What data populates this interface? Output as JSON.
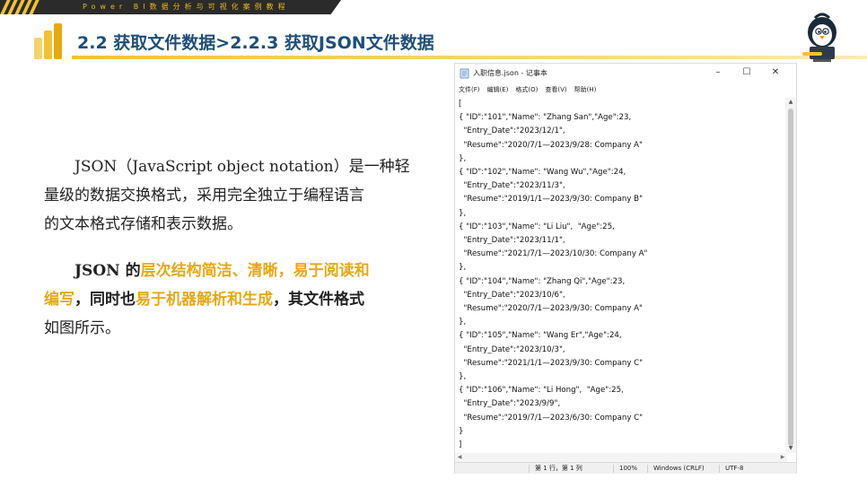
{
  "banner": {
    "text": "Power BI数据分析与可视化案例教程"
  },
  "header": {
    "title": "2.2  获取文件数据>2.2.3  获取JSON文件数据"
  },
  "colors": {
    "accent": "#f2c232",
    "title": "#1f4e79",
    "highlight": "#e6a817"
  },
  "paragraph1": {
    "line1": "JSON（JavaScript object notation）是一种轻",
    "line2": "量级的数据交换格式，采用完全独立于编程语言",
    "line3": "的文本格式存储和表示数据。"
  },
  "paragraph2": {
    "p1": "JSON ",
    "p2": "的",
    "hl1": "层次结构简洁、清晰，易于阅读和",
    "hl2": "编写",
    "p3": "，同时也",
    "hl3": "易于机器解析和生成",
    "p4": "，其文件格式",
    "p5": "如图所示。"
  },
  "notepad": {
    "title": "入职信息.json - 记事本",
    "controls": {
      "minimize": "–",
      "maximize": "☐",
      "close": "✕"
    },
    "menus": [
      "文件(F)",
      "编辑(E)",
      "格式(O)",
      "查看(V)",
      "帮助(H)"
    ],
    "content": "[\n{ \"ID\":\"101\",\"Name\": \"Zhang San\",\"Age\":23,\n  \"Entry_Date\":\"2023/12/1\",\n  \"Resume\":\"2020/7/1—2023/9/28: Company A\"\n},\n{ \"ID\":\"102\",\"Name\": \"Wang Wu\",\"Age\":24,\n  \"Entry_Date\":\"2023/11/3\",\n  \"Resume\":\"2019/1/1—2023/9/30: Company B\"\n},\n{ \"ID\":\"103\",\"Name\": \"Li Liu\",  \"Age\":25,\n  \"Entry_Date\":\"2023/11/1\",\n  \"Resume\":\"2021/7/1—2023/10/30: Company A\"\n},\n{ \"ID\":\"104\",\"Name\": \"Zhang Qi\",\"Age\":23,\n  \"Entry_Date\":\"2023/10/6\",\n  \"Resume\":\"2020/7/1—2023/9/30: Company A\"\n},\n{ \"ID\":\"105\",\"Name\": \"Wang Er\",\"Age\":24,\n  \"Entry_Date\":\"2023/10/3\",\n  \"Resume\":\"2021/1/1—2023/9/30: Company C\"\n},\n{ \"ID\":\"106\",\"Name\": \"Li Hong\",  \"Age\":25,\n  \"Entry_Date\":\"2023/9/9\",\n  \"Resume\":\"2019/7/1—2023/6/30: Company C\"\n}\n]",
    "status": {
      "position": "第 1 行，第 1 列",
      "zoom": "100%",
      "line_ending": "Windows (CRLF)",
      "encoding": "UTF-8"
    }
  }
}
